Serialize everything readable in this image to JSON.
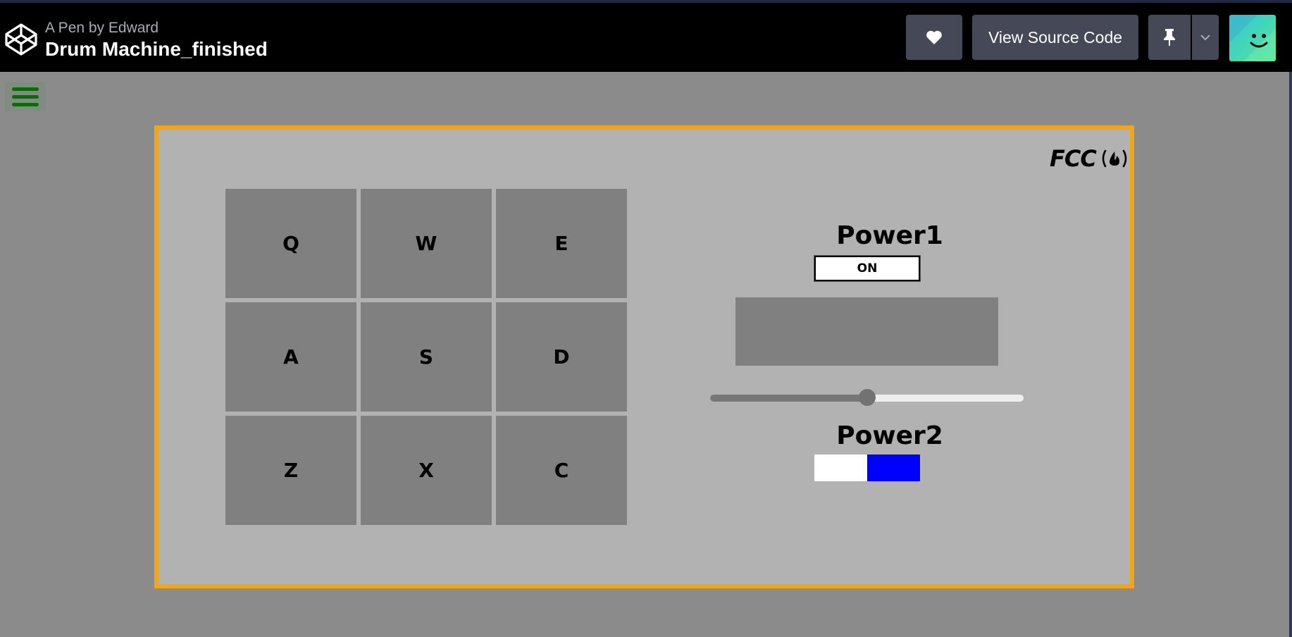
{
  "header": {
    "byline": "A Pen by Edward",
    "title": "Drum Machine_finished",
    "buttons": {
      "like_icon": "heart-icon",
      "view_source_label": "View Source Code",
      "pin_icon": "pin-icon",
      "more_icon": "chevron-down-icon"
    },
    "avatar_icon": "smiley-avatar"
  },
  "menu": {
    "icon": "hamburger-icon",
    "color": "#0a6b0a"
  },
  "drum_machine": {
    "border_color": "#f2a515",
    "logo_text": "FCC",
    "pads": [
      "Q",
      "W",
      "E",
      "A",
      "S",
      "D",
      "Z",
      "X",
      "C"
    ],
    "power1": {
      "label": "Power1",
      "state": "ON"
    },
    "display_text": "",
    "volume": {
      "value": 0.5
    },
    "power2": {
      "label": "Power2",
      "on_color": "#0000ff"
    }
  }
}
